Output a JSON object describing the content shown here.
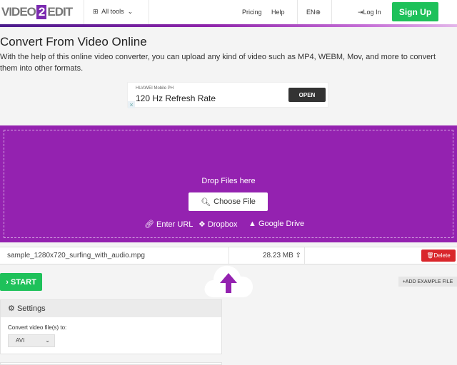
{
  "header": {
    "logo": {
      "left": "VIDEO",
      "num": "2",
      "right": "EDIT"
    },
    "all_tools": "All tools",
    "pricing": "Pricing",
    "help": "Help",
    "lang": "EN",
    "login": "Log In",
    "signup": "Sign Up"
  },
  "main": {
    "title": "Convert From Video Online",
    "description": "With the help of this online video converter, you can upload any kind of video such as MP4, WEBM, Mov, and more to convert them into other formats."
  },
  "ad": {
    "brand": "HUAWEI Mobile PH",
    "title": "120 Hz Refresh Rate",
    "cta": "OPEN"
  },
  "upload": {
    "drop_text": "Drop Files here",
    "choose": "Choose File",
    "enter_url": "Enter URL",
    "dropbox": "Dropbox",
    "google_drive": "Google Drive",
    "color": "#9422b0"
  },
  "file": {
    "name": "sample_1280x720_surfing_with_audio.mpg",
    "size": "28.23 MB",
    "delete": "Delete"
  },
  "actions": {
    "start": "START",
    "add_example": "ADD EXAMPLE FILE"
  },
  "settings": {
    "title": "Settings",
    "convert_label": "Convert video file(s) to:",
    "format": "AVI"
  }
}
